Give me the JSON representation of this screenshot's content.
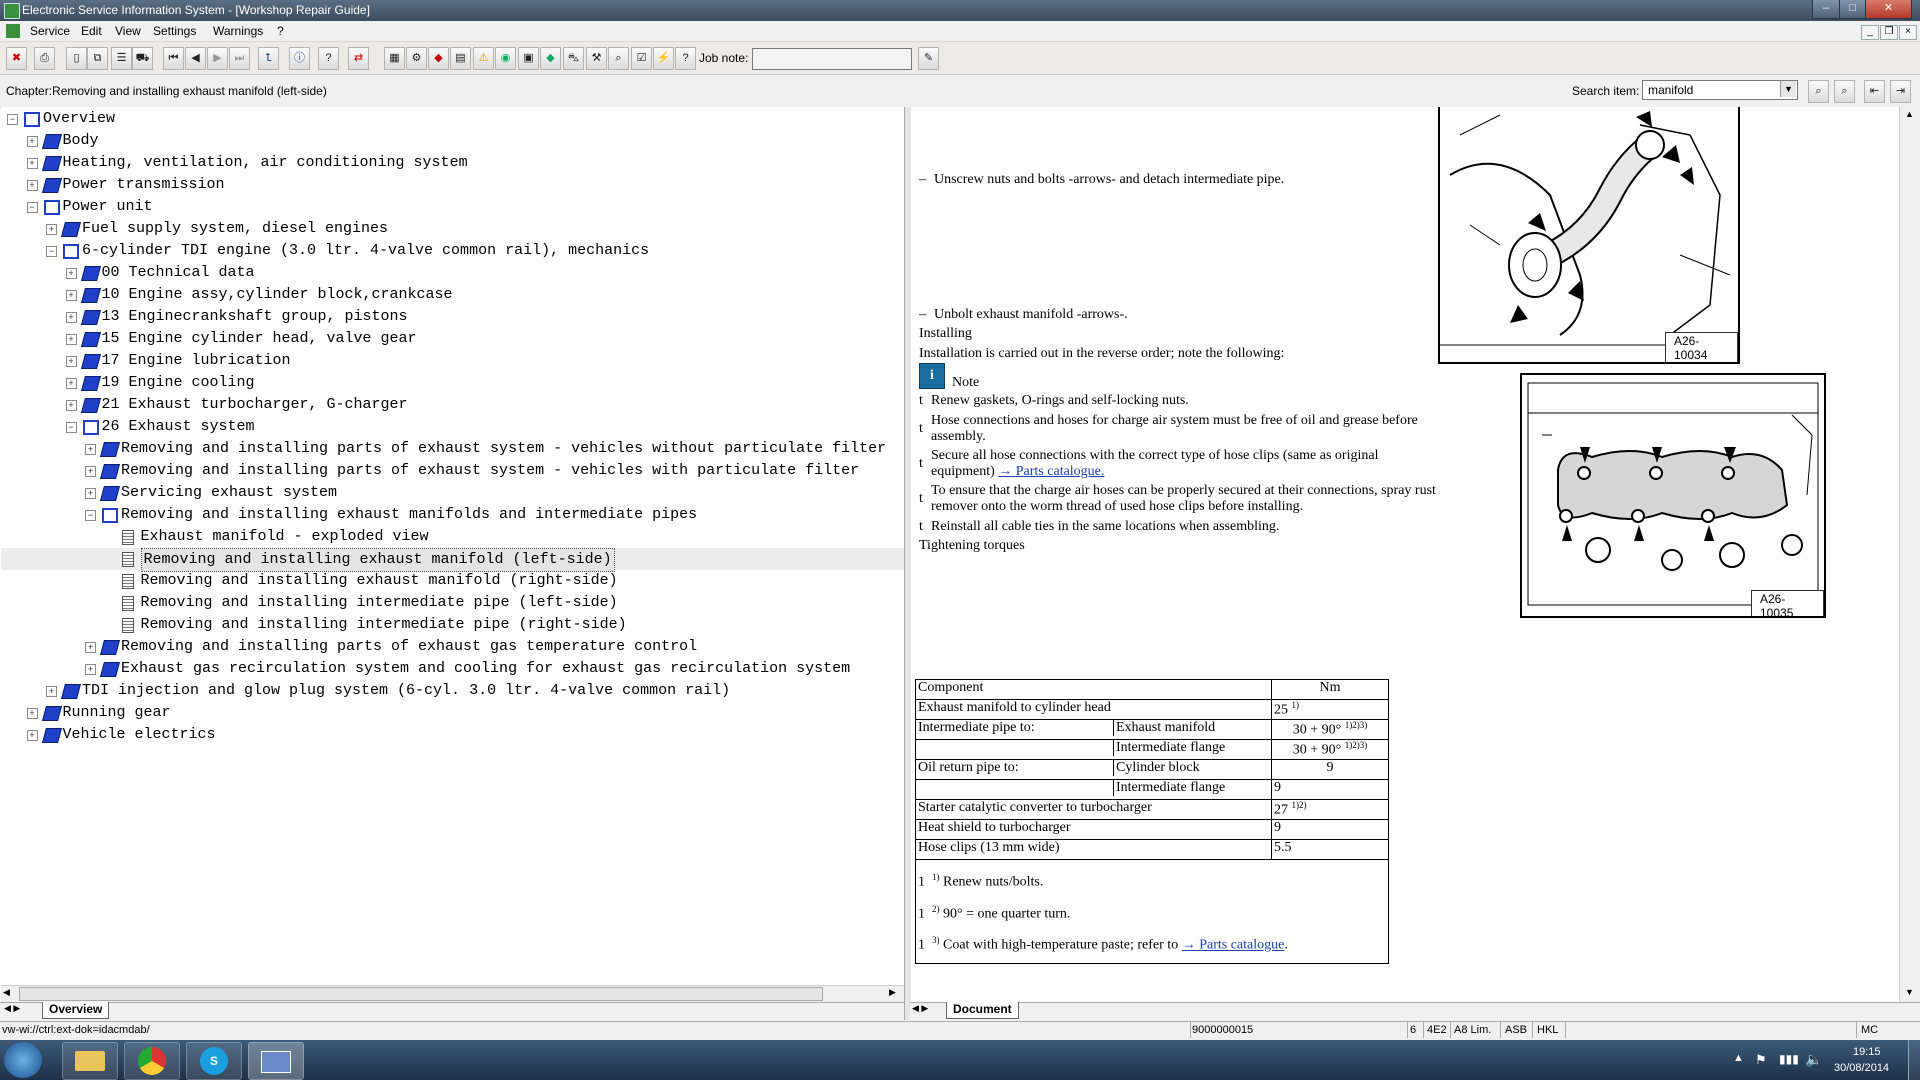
{
  "window": {
    "title": "Electronic Service Information System - [Workshop Repair Guide]"
  },
  "menu": [
    "Service",
    "Edit",
    "View",
    "Settings",
    "Warnings",
    "?"
  ],
  "toolbar": {
    "job_note_label": "Job note:",
    "job_note_value": ""
  },
  "chapter": "Chapter:Removing and installing exhaust manifold (left-side)",
  "search": {
    "label": "Search item:",
    "value": "manifold"
  },
  "tree": [
    {
      "label": "Overview",
      "level": 0,
      "exp": "-",
      "icon": "open"
    },
    {
      "label": "Body",
      "level": 1,
      "exp": "+",
      "icon": "closed"
    },
    {
      "label": "Heating, ventilation, air conditioning system",
      "level": 1,
      "exp": "+",
      "icon": "closed"
    },
    {
      "label": "Power transmission",
      "level": 1,
      "exp": "+",
      "icon": "closed"
    },
    {
      "label": "Power unit",
      "level": 1,
      "exp": "-",
      "icon": "open"
    },
    {
      "label": "Fuel supply system, diesel engines",
      "level": 2,
      "exp": "+",
      "icon": "closed"
    },
    {
      "label": "6-cylinder TDI engine (3.0 ltr. 4-valve common rail), mechanics",
      "level": 2,
      "exp": "-",
      "icon": "open"
    },
    {
      "label": "00 Technical data",
      "level": 3,
      "exp": "+",
      "icon": "closed"
    },
    {
      "label": "10 Engine assy,cylinder block,crankcase",
      "level": 3,
      "exp": "+",
      "icon": "closed"
    },
    {
      "label": "13 Enginecrankshaft group, pistons",
      "level": 3,
      "exp": "+",
      "icon": "closed"
    },
    {
      "label": "15 Engine cylinder head, valve gear",
      "level": 3,
      "exp": "+",
      "icon": "closed"
    },
    {
      "label": "17 Engine lubrication",
      "level": 3,
      "exp": "+",
      "icon": "closed"
    },
    {
      "label": "19 Engine cooling",
      "level": 3,
      "exp": "+",
      "icon": "closed"
    },
    {
      "label": "21 Exhaust turbocharger, G-charger",
      "level": 3,
      "exp": "+",
      "icon": "closed"
    },
    {
      "label": "26 Exhaust system",
      "level": 3,
      "exp": "-",
      "icon": "open"
    },
    {
      "label": "Removing and installing parts of exhaust system - vehicles without particulate filter",
      "level": 4,
      "exp": "+",
      "icon": "closed"
    },
    {
      "label": "Removing and installing parts of exhaust system - vehicles with particulate filter",
      "level": 4,
      "exp": "+",
      "icon": "closed"
    },
    {
      "label": "Servicing exhaust system",
      "level": 4,
      "exp": "+",
      "icon": "closed"
    },
    {
      "label": "Removing and installing exhaust manifolds and intermediate pipes",
      "level": 4,
      "exp": "-",
      "icon": "open"
    },
    {
      "label": "Exhaust manifold - exploded view",
      "level": 5,
      "exp": "",
      "icon": "doc"
    },
    {
      "label": "Removing and installing exhaust manifold (left-side)",
      "level": 5,
      "exp": "",
      "icon": "doc",
      "selected": true
    },
    {
      "label": "Removing and installing exhaust manifold (right-side)",
      "level": 5,
      "exp": "",
      "icon": "doc"
    },
    {
      "label": "Removing and installing intermediate pipe (left-side)",
      "level": 5,
      "exp": "",
      "icon": "doc"
    },
    {
      "label": "Removing and installing intermediate pipe (right-side)",
      "level": 5,
      "exp": "",
      "icon": "doc"
    },
    {
      "label": "Removing and installing parts of exhaust gas temperature control",
      "level": 4,
      "exp": "+",
      "icon": "closed"
    },
    {
      "label": "Exhaust gas recirculation system and cooling for exhaust gas recirculation system",
      "level": 4,
      "exp": "+",
      "icon": "closed"
    },
    {
      "label": "TDI injection and glow plug system (6-cyl. 3.0 ltr. 4-valve common rail)",
      "level": 2,
      "exp": "+",
      "icon": "closed"
    },
    {
      "label": "Running gear",
      "level": 1,
      "exp": "+",
      "icon": "closed"
    },
    {
      "label": "Vehicle electrics",
      "level": 1,
      "exp": "+",
      "icon": "closed"
    }
  ],
  "doc": {
    "step1": "Unscrew nuts and bolts -arrows- and detach intermediate pipe.",
    "step2": "Unbolt exhaust manifold -arrows-.",
    "installing": "Installing",
    "install_note": "Installation is carried out in the reverse order; note the following:",
    "note": "Note",
    "bullets": [
      "Renew gaskets, O-rings and self-locking nuts.",
      "Hose connections and hoses for charge air system must be free of oil and grease before",
      "assembly.",
      "Secure all hose connections with the correct type of hose clips (same as original",
      "equipment)",
      "To ensure that the charge air hoses can be properly secured at their connections, spray rust",
      "remover onto the worm thread of used hose clips before installing.",
      "Reinstall all cable ties in the same locations when assembling."
    ],
    "parts_link": "→ Parts catalogue.",
    "parts_link2": "→ Parts catalogue",
    "fig1": "A26-10034",
    "fig2": "A26-10035",
    "torque_title": "Tightening torques",
    "table": {
      "h_component": "Component",
      "h_nm": "Nm",
      "r1": "Exhaust manifold to cylinder head",
      "r1v": "25",
      "r1s": "1)",
      "r2": "Intermediate pipe to:",
      "r2a": "Exhaust manifold",
      "r2av": "30 + 90°",
      "r2as": "1)2)3)",
      "r2b": "Intermediate flange",
      "r2bv": "30 + 90°",
      "r2bs": "1)2)3)",
      "r3": "Oil return pipe to:",
      "r3a": "Cylinder block",
      "r3av": "9",
      "r3b": "Intermediate flange",
      "r3bv": "9",
      "r4": "Starter catalytic converter to turbocharger",
      "r4v": "27",
      "r4s": "1)2)",
      "r5": "Heat shield to turbocharger",
      "r5v": "9",
      "r6": "Hose clips (13 mm wide)",
      "r6v": "5.5"
    },
    "footnotes": [
      {
        "sup": "1)",
        "text": "Renew nuts/bolts."
      },
      {
        "sup": "2)",
        "text": "90° = one quarter turn."
      },
      {
        "sup": "3)",
        "text": "Coat with high-temperature paste; refer to"
      }
    ],
    "footnote_end": "."
  },
  "tabs": {
    "left": "Overview",
    "right": "Document"
  },
  "status": {
    "url": "vw-wi://ctrl:ext-dok=idacmdab/",
    "id": "9000000015",
    "f1": "6",
    "f2": "4E2",
    "f3": "A8 Lim.",
    "f4": "ASB",
    "f5": "HKL",
    "f6": "MC"
  },
  "clock": {
    "time": "19:15",
    "date": "30/08/2014"
  }
}
